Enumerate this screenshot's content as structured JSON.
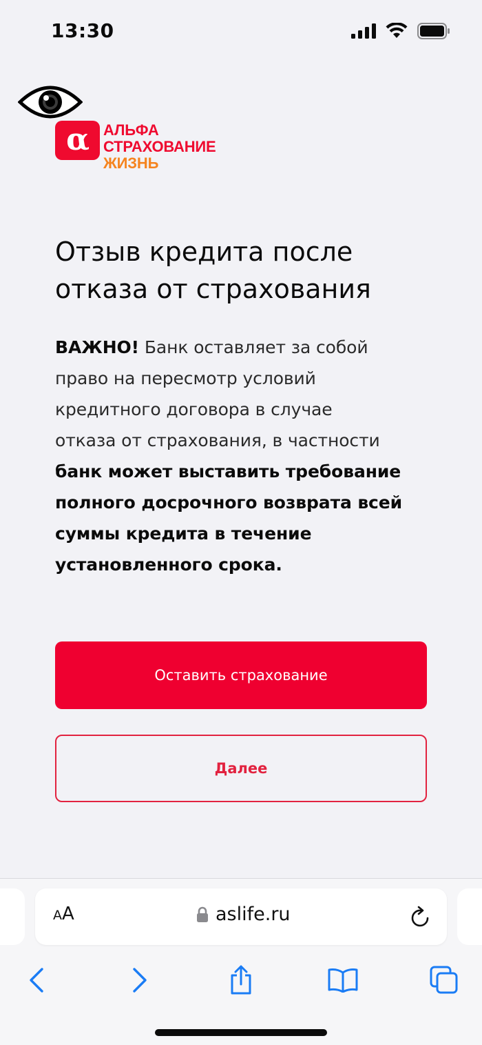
{
  "status_bar": {
    "time": "13:30"
  },
  "logo": {
    "mark": "α",
    "line1": "АЛЬФА",
    "line2": "СТРАХОВАНИЕ",
    "line3": "ЖИЗНЬ",
    "brand_color": "#ef0a2f",
    "accent_color": "#f5841f"
  },
  "page": {
    "title_line1": "Отзыв кредита после",
    "title_line2": "отказа от страхования",
    "notice": {
      "lead_bold": "ВАЖНО!",
      "line1_rest": " Банк оставляет за собой",
      "line2": "право на пересмотр условий",
      "line3": "кредитного договора в случае",
      "line4": "отказа от страхования, в частности",
      "line5": "банк может выставить требование",
      "line6": "полного досрочного возврата всей",
      "line7": "суммы кредита в течение",
      "line8": "установленного срока."
    }
  },
  "actions": {
    "keep_insurance_label": "Оставить страхование",
    "next_label": "Далее"
  },
  "browser": {
    "text_size_button": {
      "small": "A",
      "large": "A"
    },
    "url": "aslife.ru",
    "icons": [
      "lock-icon",
      "reload-icon",
      "back-icon",
      "forward-icon",
      "share-icon",
      "bookmarks-icon",
      "tabs-icon"
    ]
  }
}
